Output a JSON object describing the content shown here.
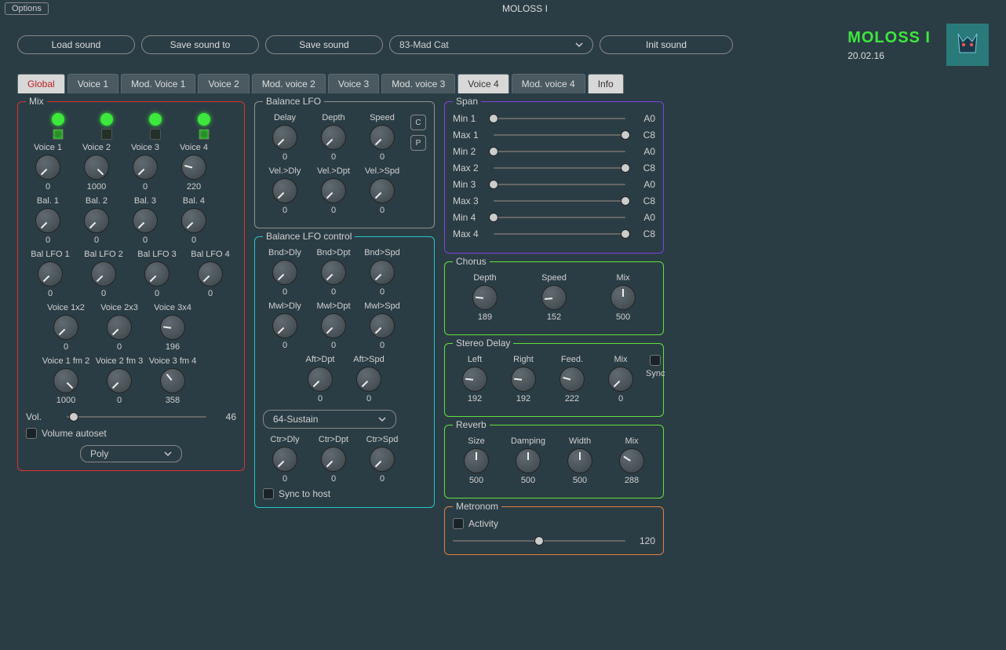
{
  "window": {
    "options": "Options",
    "title": "MOLOSS I"
  },
  "topbar": {
    "load": "Load sound",
    "saveTo": "Save sound to",
    "save": "Save sound",
    "preset": "83-Mad Cat",
    "init": "Init sound"
  },
  "brand": {
    "name": "MOLOSS I",
    "date": "20.02.16"
  },
  "tabs": [
    "Global",
    "Voice 1",
    "Mod. Voice 1",
    "Voice 2",
    "Mod. voice 2",
    "Voice 3",
    "Mod. voice 3",
    "Voice 4",
    "Mod. voice 4",
    "Info"
  ],
  "mix": {
    "title": "Mix",
    "voiceLabels": [
      "Voice 1",
      "Voice 2",
      "Voice 3",
      "Voice 4"
    ],
    "voiceVals": [
      0,
      1000,
      0,
      220
    ],
    "balLabels": [
      "Bal. 1",
      "Bal. 2",
      "Bal. 3",
      "Bal. 4"
    ],
    "balVals": [
      0,
      0,
      0,
      0
    ],
    "balLfoLabels": [
      "Bal LFO 1",
      "Bal LFO 2",
      "Bal LFO 3",
      "Bal LFO 4"
    ],
    "balLfoVals": [
      0,
      0,
      0,
      0
    ],
    "xmodLabels": [
      "Voice 1x2",
      "Voice 2x3",
      "Voice 3x4"
    ],
    "xmodVals": [
      0,
      0,
      196
    ],
    "fmLabels": [
      "Voice 1 fm 2",
      "Voice 2 fm 3",
      "Voice 3 fm 4"
    ],
    "fmVals": [
      1000,
      0,
      358
    ],
    "volLabel": "Vol.",
    "volVal": 46,
    "autoset": "Volume autoset",
    "poly": "Poly"
  },
  "balLfo": {
    "title": "Balance LFO",
    "r1Labels": [
      "Delay",
      "Depth",
      "Speed"
    ],
    "r1Vals": [
      0,
      0,
      0
    ],
    "r2Labels": [
      "Vel.>Dly",
      "Vel.>Dpt",
      "Vel.>Spd"
    ],
    "r2Vals": [
      0,
      0,
      0
    ],
    "btnC": "C",
    "btnP": "P"
  },
  "balLfoCtrl": {
    "title": "Balance LFO control",
    "r1Labels": [
      "Bnd>Dly",
      "Bnd>Dpt",
      "Bnd>Spd"
    ],
    "r1Vals": [
      0,
      0,
      0
    ],
    "r2Labels": [
      "Mwl>Dly",
      "Mwl>Dpt",
      "Mwl>Spd"
    ],
    "r2Vals": [
      0,
      0,
      0
    ],
    "r3Labels": [
      "Aft>Dpt",
      "Aft>Spd"
    ],
    "r3Vals": [
      0,
      0
    ],
    "ctrSel": "64-Sustain",
    "r4Labels": [
      "Ctr>Dly",
      "Ctr>Dpt",
      "Ctr>Spd"
    ],
    "r4Vals": [
      0,
      0,
      0
    ],
    "sync": "Sync to host"
  },
  "span": {
    "title": "Span",
    "rows": [
      {
        "l": "Min 1",
        "p": 0,
        "v": "A0"
      },
      {
        "l": "Max 1",
        "p": 100,
        "v": "C8"
      },
      {
        "l": "Min 2",
        "p": 0,
        "v": "A0"
      },
      {
        "l": "Max 2",
        "p": 100,
        "v": "C8"
      },
      {
        "l": "Min 3",
        "p": 0,
        "v": "A0"
      },
      {
        "l": "Max 3",
        "p": 100,
        "v": "C8"
      },
      {
        "l": "Min 4",
        "p": 0,
        "v": "A0"
      },
      {
        "l": "Max 4",
        "p": 100,
        "v": "C8"
      }
    ]
  },
  "chorus": {
    "title": "Chorus",
    "labels": [
      "Depth",
      "Speed",
      "Mix"
    ],
    "vals": [
      189,
      152,
      500
    ]
  },
  "delay": {
    "title": "Stereo Delay",
    "labels": [
      "Left",
      "Right",
      "Feed.",
      "Mix"
    ],
    "vals": [
      192,
      192,
      222,
      0
    ],
    "sync": "Sync"
  },
  "reverb": {
    "title": "Reverb",
    "labels": [
      "Size",
      "Damping",
      "Width",
      "Mix"
    ],
    "vals": [
      500,
      500,
      500,
      288
    ]
  },
  "metro": {
    "title": "Metronom",
    "activity": "Activity",
    "val": 120
  }
}
